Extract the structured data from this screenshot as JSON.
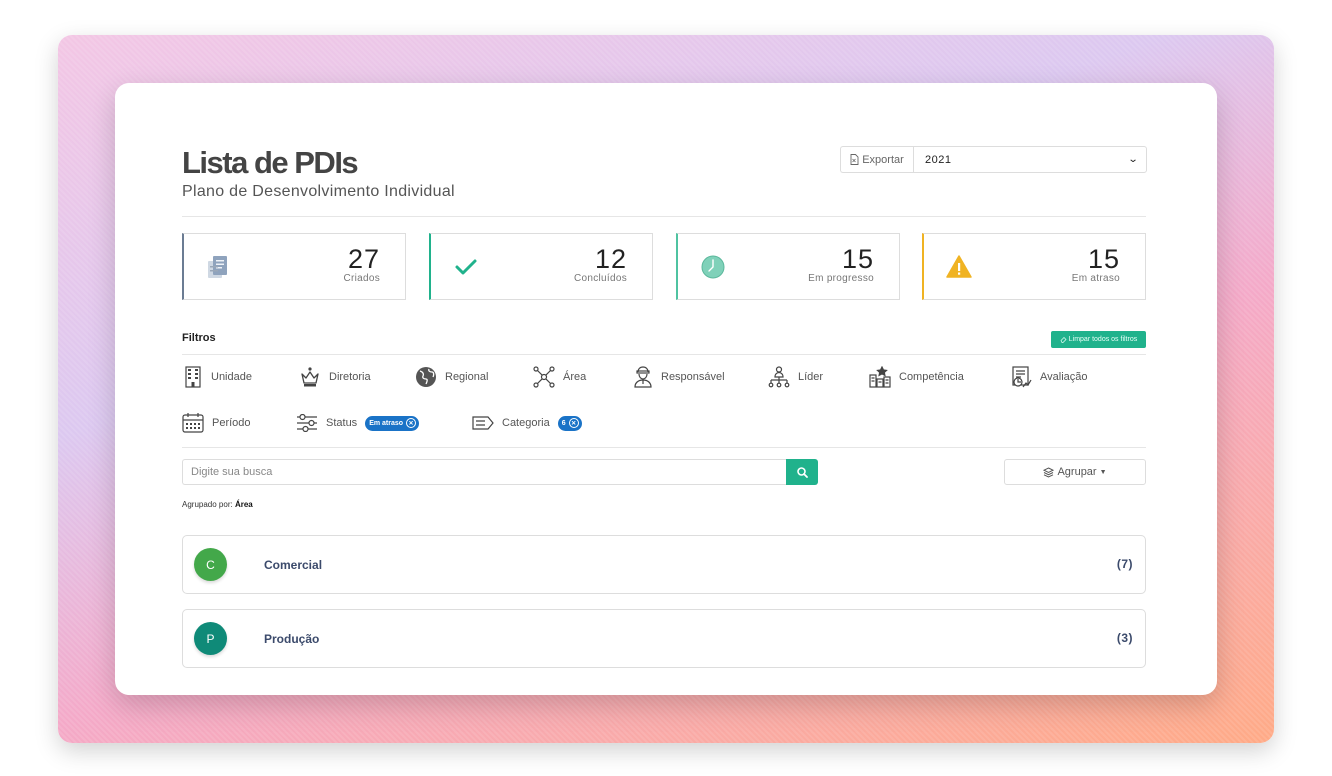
{
  "header": {
    "title": "Lista de PDIs",
    "subtitle": "Plano de Desenvolvimento Individual",
    "export_label": "Exportar",
    "year": "2021"
  },
  "stats": [
    {
      "value": "27",
      "label": "Criados",
      "icon": "documents-icon",
      "color": "#6b7c93"
    },
    {
      "value": "12",
      "label": "Concluídos",
      "icon": "check-icon",
      "color": "#20b28c"
    },
    {
      "value": "15",
      "label": "Em progresso",
      "icon": "clock-icon",
      "color": "#4fc3a1"
    },
    {
      "value": "15",
      "label": "Em atraso",
      "icon": "warning-icon",
      "color": "#f0b323"
    }
  ],
  "filters": {
    "title": "Filtros",
    "clear_all": "Limpar todos os filtros",
    "items": [
      {
        "label": "Unidade",
        "icon": "building-icon"
      },
      {
        "label": "Diretoria",
        "icon": "crown-icon"
      },
      {
        "label": "Regional",
        "icon": "globe-icon"
      },
      {
        "label": "Área",
        "icon": "network-icon"
      },
      {
        "label": "Responsável",
        "icon": "person-icon"
      },
      {
        "label": "Líder",
        "icon": "hierarchy-icon"
      },
      {
        "label": "Competência",
        "icon": "competence-icon"
      },
      {
        "label": "Avaliação",
        "icon": "evaluation-icon"
      },
      {
        "label": "Período",
        "icon": "calendar-icon"
      },
      {
        "label": "Status",
        "icon": "sliders-icon",
        "chip": "Em atraso"
      },
      {
        "label": "Categoria",
        "icon": "tag-icon",
        "chip": "6"
      }
    ]
  },
  "search": {
    "placeholder": "Digite sua busca"
  },
  "grouping": {
    "button_label": "Agrupar",
    "grouped_by_label": "Agrupado por:",
    "grouped_by_value": "Área"
  },
  "groups": [
    {
      "initial": "C",
      "name": "Comercial",
      "count": "(7)",
      "color": "#43a84a"
    },
    {
      "initial": "P",
      "name": "Produção",
      "count": "(3)",
      "color": "#0f8a78"
    }
  ]
}
